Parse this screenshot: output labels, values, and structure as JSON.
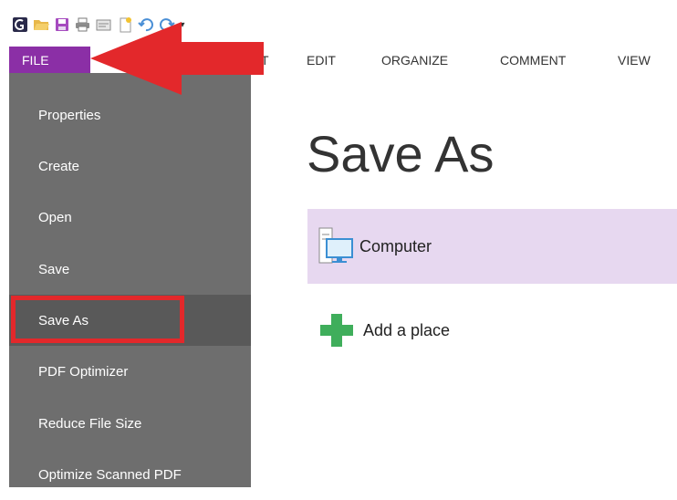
{
  "colors": {
    "file_tab": "#8b2fa6",
    "menu_bg": "#6e6e6e",
    "menu_active": "#595959",
    "computer_bg": "#e7d8f0",
    "callout_red": "#e3282b",
    "add_green": "#3fae5b"
  },
  "quick_access": {
    "icons": [
      "app-logo-icon",
      "open-folder-icon",
      "save-icon",
      "print-icon",
      "scan-icon",
      "new-document-icon",
      "undo-icon",
      "redo-icon",
      "customize-dropdown-icon"
    ],
    "more_glyph": "▾"
  },
  "ribbon": {
    "file_label": "FILE",
    "tabs": [
      "T",
      "EDIT",
      "ORGANIZE",
      "COMMENT",
      "VIEW"
    ]
  },
  "backstage_menu": {
    "items": [
      "Properties",
      "Create",
      "Open",
      "Save",
      "Save As",
      "PDF Optimizer",
      "Reduce File Size",
      "Optimize Scanned PDF"
    ],
    "active": "Save As"
  },
  "main": {
    "title": "Save As",
    "places": {
      "computer_label": "Computer",
      "add_label": "Add a place"
    }
  }
}
